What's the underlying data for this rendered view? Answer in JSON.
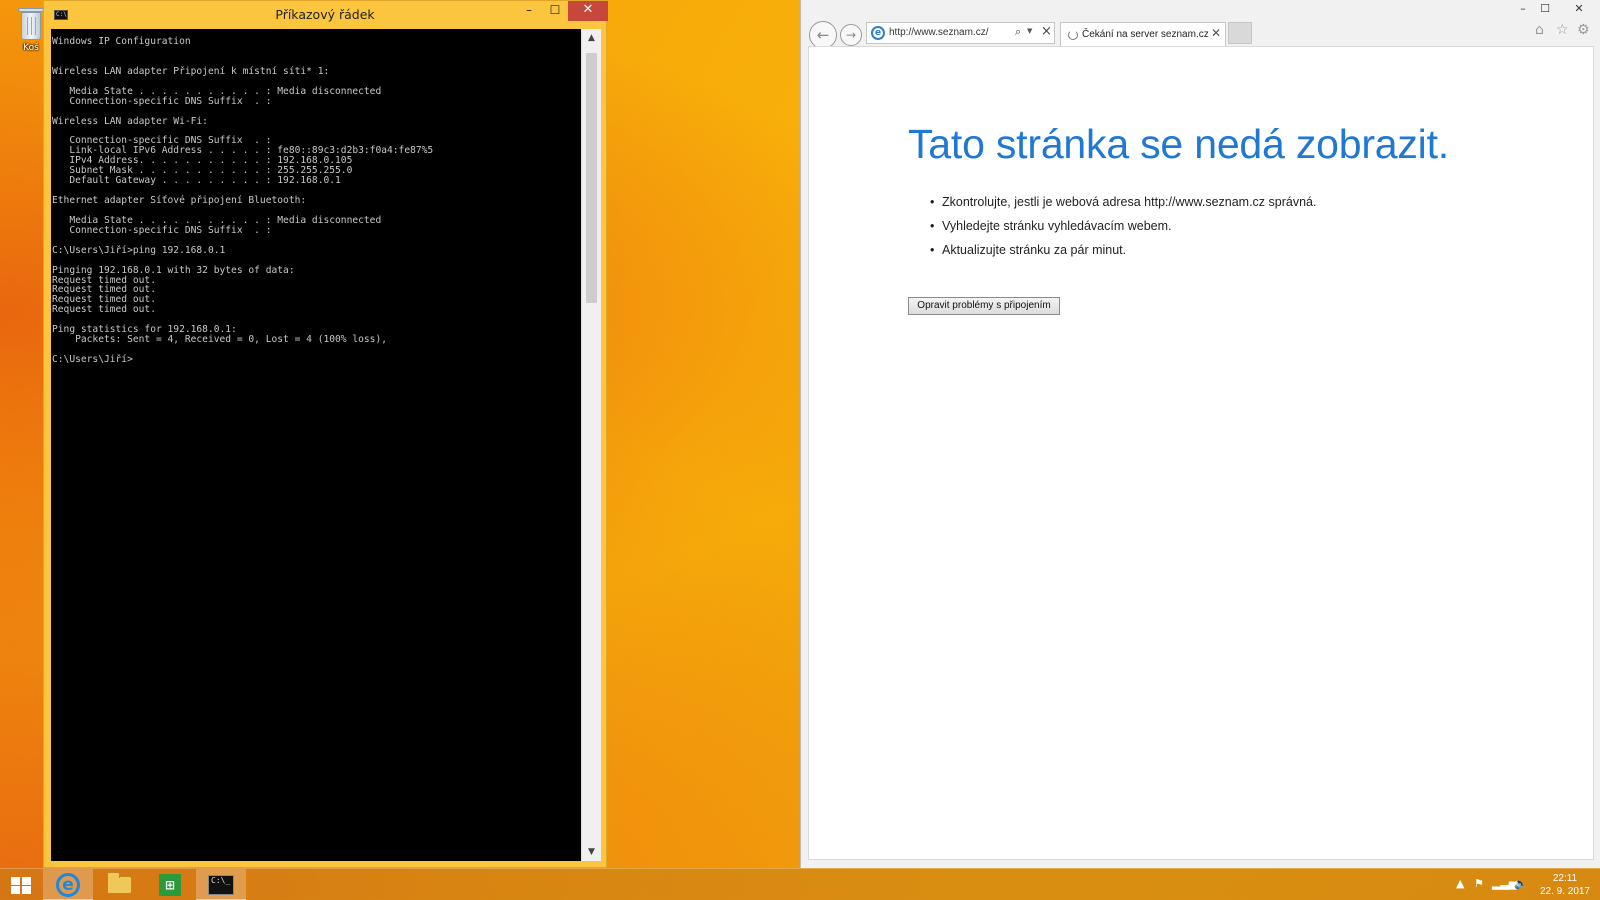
{
  "desktop": {
    "recycle_bin_label": "Koš"
  },
  "cmd_window": {
    "title": "Příkazový řádek",
    "icon_text": "C:\\",
    "minimize": "–",
    "maximize": "☐",
    "close": "✕",
    "lines": [
      "Windows IP Configuration",
      "",
      "",
      "Wireless LAN adapter Připojení k místní síti* 1:",
      "",
      "   Media State . . . . . . . . . . . : Media disconnected",
      "   Connection-specific DNS Suffix  . :",
      "",
      "Wireless LAN adapter Wi-Fi:",
      "",
      "   Connection-specific DNS Suffix  . :",
      "   Link-local IPv6 Address . . . . . : fe80::89c3:d2b3:f0a4:fe87%5",
      "   IPv4 Address. . . . . . . . . . . : 192.168.0.105",
      "   Subnet Mask . . . . . . . . . . . : 255.255.255.0",
      "   Default Gateway . . . . . . . . . : 192.168.0.1",
      "",
      "Ethernet adapter Síťové připojení Bluetooth:",
      "",
      "   Media State . . . . . . . . . . . : Media disconnected",
      "   Connection-specific DNS Suffix  . :",
      "",
      "C:\\Users\\Jiří>ping 192.168.0.1",
      "",
      "Pinging 192.168.0.1 with 32 bytes of data:",
      "Request timed out.",
      "Request timed out.",
      "Request timed out.",
      "Request timed out.",
      "",
      "Ping statistics for 192.168.0.1:",
      "    Packets: Sent = 4, Received = 0, Lost = 4 (100% loss),",
      "",
      "C:\\Users\\Jiří>"
    ]
  },
  "ie_window": {
    "caption": {
      "minimize": "–",
      "maximize": "☐",
      "close": "✕"
    },
    "address": {
      "url": "http://www.seznam.cz/"
    },
    "tab": {
      "label": "Čekání na server seznam.cz",
      "close": "✕"
    },
    "error": {
      "title": "Tato stránka se nedá zobrazit.",
      "bullets": [
        "Zkontrolujte, jestli je webová adresa http://www.seznam.cz správná.",
        "Vyhledejte stránku vyhledávacím webem.",
        "Aktualizujte stránku za pár minut."
      ],
      "fix_button": "Opravit problémy s připojením"
    }
  },
  "taskbar": {
    "clock_time": "22:11",
    "clock_date": "22. 9. 2017",
    "cmd_icon_text": "C:\\_"
  }
}
